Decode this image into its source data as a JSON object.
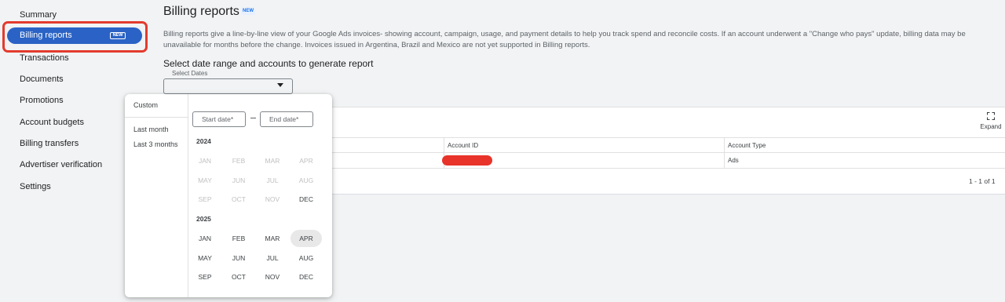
{
  "sidebar": {
    "items": [
      {
        "label": "Summary"
      },
      {
        "label": "Billing reports",
        "badge": "NEW",
        "active": true
      },
      {
        "label": "Transactions"
      },
      {
        "label": "Documents"
      },
      {
        "label": "Promotions"
      },
      {
        "label": "Account budgets"
      },
      {
        "label": "Billing transfers"
      },
      {
        "label": "Advertiser verification"
      },
      {
        "label": "Settings"
      }
    ]
  },
  "main": {
    "title": "Billing reports",
    "title_badge": "NEW",
    "description": "Billing reports give a line-by-line view of your Google Ads invoices- showing account, campaign, usage, and payment details to help you track spend and reconcile costs. If an account underwent a \"Change who pays\" update, billing data may be unavailable for months before the change. Invoices issued in Argentina, Brazil and Mexico are not yet supported in Billing reports.",
    "section_heading": "Select date range and accounts to generate report",
    "select_label": "Select Dates",
    "select_value": ""
  },
  "table": {
    "expand_label": "Expand",
    "columns": [
      "Account ID",
      "Account Type"
    ],
    "rows": [
      {
        "account_type": "Ads"
      }
    ],
    "pagination": "1 - 1 of 1"
  },
  "date_picker": {
    "presets": [
      "Custom",
      "Last month",
      "Last 3 months"
    ],
    "start_placeholder": "Start date*",
    "end_placeholder": "End date*",
    "years": [
      {
        "year": "2024",
        "months": [
          {
            "label": "JAN",
            "enabled": false
          },
          {
            "label": "FEB",
            "enabled": false
          },
          {
            "label": "MAR",
            "enabled": false
          },
          {
            "label": "APR",
            "enabled": false
          },
          {
            "label": "MAY",
            "enabled": false
          },
          {
            "label": "JUN",
            "enabled": false
          },
          {
            "label": "JUL",
            "enabled": false
          },
          {
            "label": "AUG",
            "enabled": false
          },
          {
            "label": "SEP",
            "enabled": false
          },
          {
            "label": "OCT",
            "enabled": false
          },
          {
            "label": "NOV",
            "enabled": false
          },
          {
            "label": "DEC",
            "enabled": true
          }
        ]
      },
      {
        "year": "2025",
        "months": [
          {
            "label": "JAN",
            "enabled": true
          },
          {
            "label": "FEB",
            "enabled": true
          },
          {
            "label": "MAR",
            "enabled": true
          },
          {
            "label": "APR",
            "enabled": true,
            "highlighted": true
          },
          {
            "label": "MAY",
            "enabled": true
          },
          {
            "label": "JUN",
            "enabled": true
          },
          {
            "label": "JUL",
            "enabled": true
          },
          {
            "label": "AUG",
            "enabled": true
          },
          {
            "label": "SEP",
            "enabled": true
          },
          {
            "label": "OCT",
            "enabled": true
          },
          {
            "label": "NOV",
            "enabled": true
          },
          {
            "label": "DEC",
            "enabled": true
          }
        ]
      }
    ]
  },
  "colors": {
    "accent": "#2a63c5",
    "annotation_red": "#e33b2e",
    "redaction_red": "#e8332a"
  }
}
